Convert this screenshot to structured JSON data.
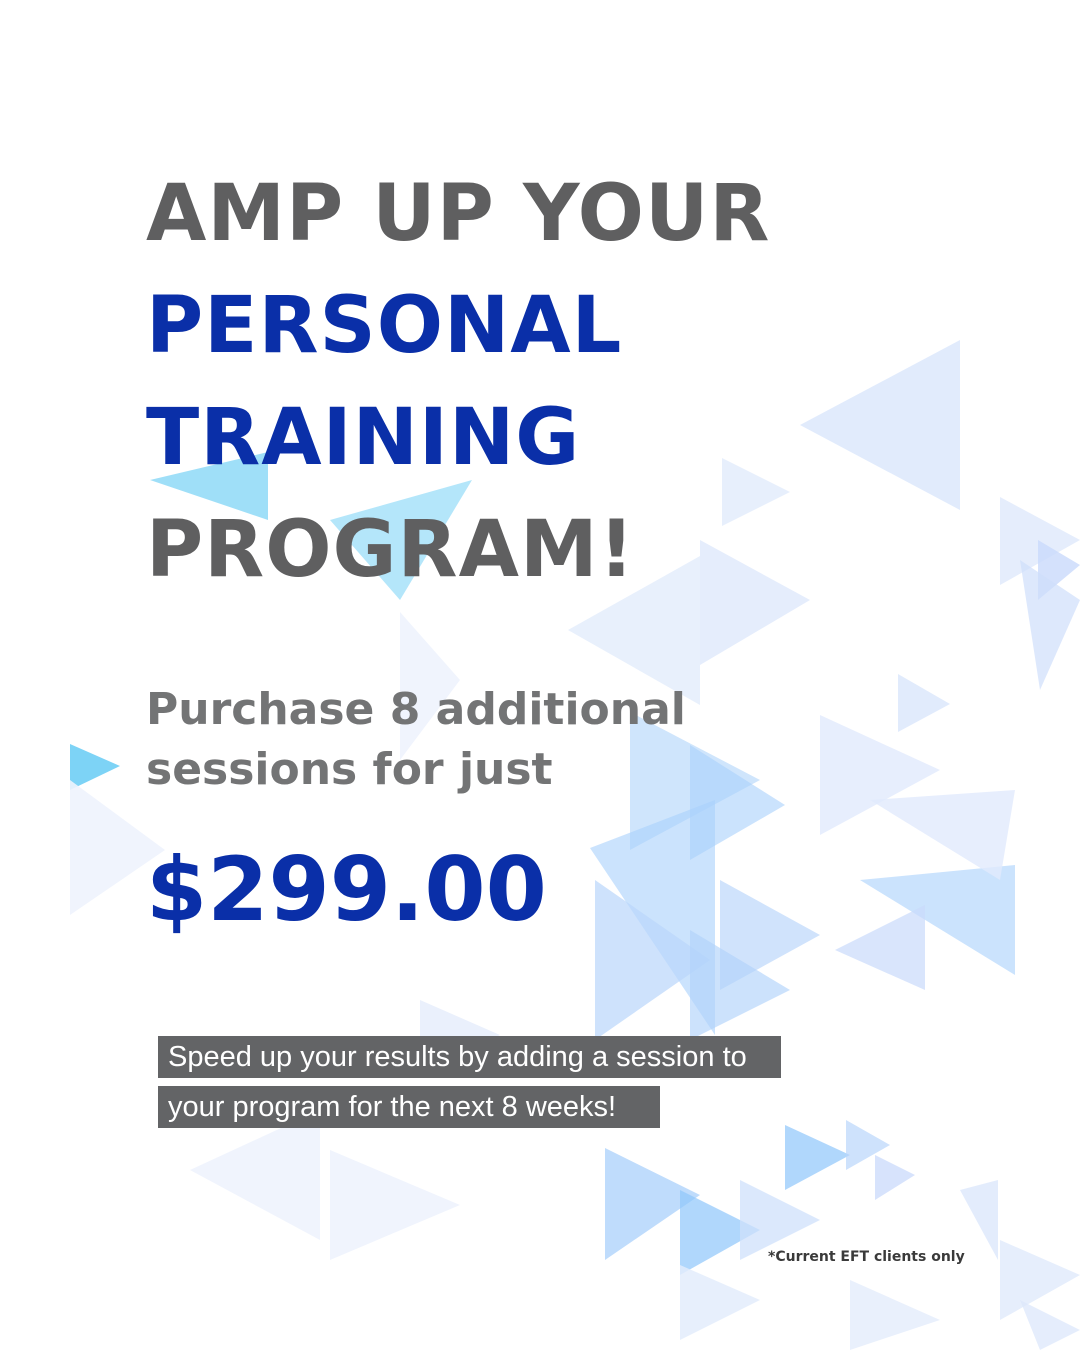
{
  "headline": {
    "line1": "AMP UP YOUR",
    "line2": "PERSONAL",
    "line3": "TRAINING",
    "line4": "PROGRAM!"
  },
  "offer": {
    "line1": "Purchase 8 additional",
    "line2": "sessions for just",
    "price": "$299.00"
  },
  "note": {
    "line1": "Speed up your results by adding a session to",
    "line2": "your program for the next 8 weeks!"
  },
  "footnote": "*Current EFT clients only",
  "colors": {
    "headline_gray": "#5f5f60",
    "headline_blue": "#0a2fa8",
    "subtext_gray": "#737475",
    "note_bar": "#636466",
    "triangle_light": "#dce7fb",
    "triangle_mid": "#b9d6fb",
    "triangle_cyan": "#76d1f5"
  }
}
